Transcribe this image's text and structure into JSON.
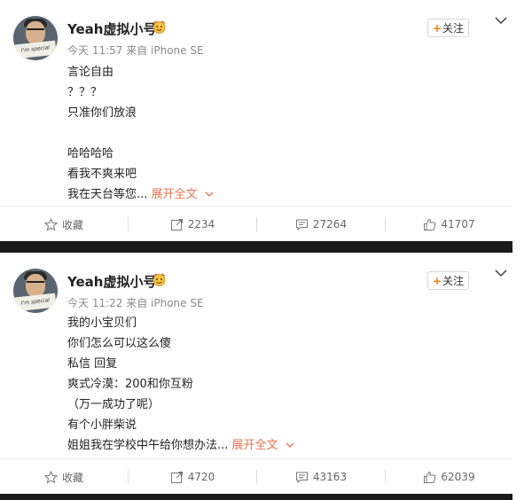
{
  "posts": [
    {
      "username": "Yeah虚拟小号",
      "meta": "今天 11:57 来自 iPhone SE",
      "follow_label": "关注",
      "lines": [
        "言论自由",
        "？？？",
        "只准你们放浪",
        "",
        "哈哈哈哈",
        "看我不爽来吧",
        "我在天台等您..."
      ],
      "expand_label": "展开全文",
      "actions": {
        "favorite": "收藏",
        "repost": "2234",
        "comment": "27264",
        "like": "41707"
      }
    },
    {
      "username": "Yeah虚拟小号",
      "meta": "今天 11:22 来自 iPhone SE",
      "follow_label": "关注",
      "lines": [
        "我的小宝贝们",
        "你们怎么可以这么傻",
        "私信 回复",
        "爽式冷漠：200和你互粉",
        "（万一成功了呢）",
        "有个小胖柴说",
        "姐姐我在学校中午给你想办法..."
      ],
      "expand_label": "展开全文",
      "actions": {
        "favorite": "收藏",
        "repost": "4720",
        "comment": "43163",
        "like": "62039"
      }
    }
  ],
  "colors": {
    "accent": "#eb7350",
    "follow_plus": "#f77c00",
    "divider": "#1a1a1a"
  },
  "icons": [
    "avatar",
    "emoji-icon",
    "chevron-down-icon",
    "star-icon",
    "repost-icon",
    "comment-icon",
    "thumbs-up-icon"
  ]
}
